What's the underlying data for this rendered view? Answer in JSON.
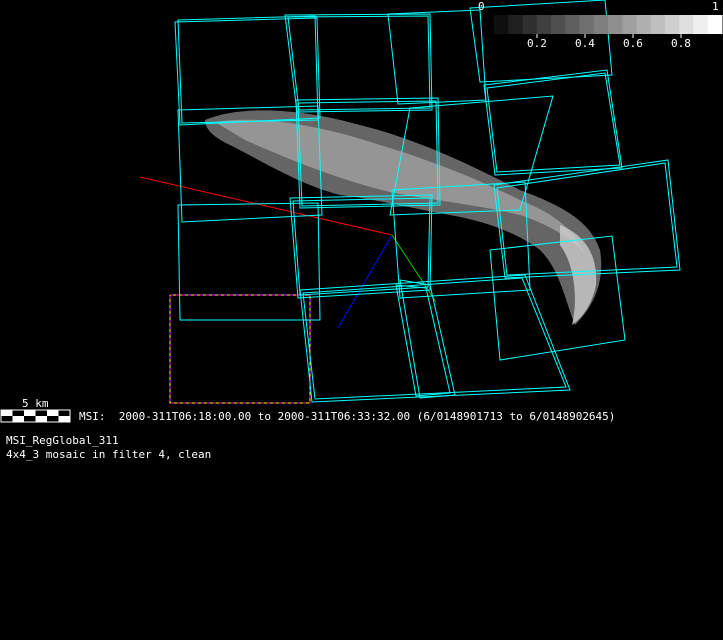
{
  "colorbar": {
    "min_label": "0",
    "max_label": "1",
    "ticks": [
      {
        "value": 0.2,
        "label": "0.2"
      },
      {
        "value": 0.4,
        "label": "0.4"
      },
      {
        "value": 0.6,
        "label": "0.6"
      },
      {
        "value": 0.8,
        "label": "0.8"
      }
    ],
    "steps": 16
  },
  "scale_bar": {
    "label": "5 km"
  },
  "info": {
    "time_range": "MSI:  2000-311T06:18:00.00 to 2000-311T06:33:32.00 (6/0148901713 to 6/0148902645)",
    "mosaic_name": "MSI_RegGlobal_311",
    "description": "4x4_3 mosaic in filter 4, clean"
  },
  "colors": {
    "footprint": "#00ffff",
    "x_axis": "#ff0000",
    "y_axis": "#00ff00",
    "z_axis": "#0000ff",
    "dashed_box": "#ff00ff"
  }
}
